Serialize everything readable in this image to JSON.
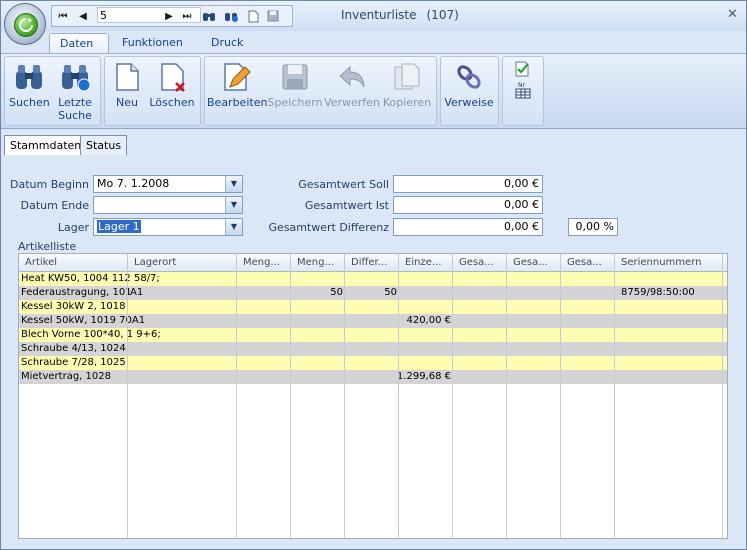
{
  "window": {
    "title": "Inventurliste",
    "count": "(107)",
    "close": "✕"
  },
  "nav": {
    "first": "⏮",
    "prev": "◀",
    "record": "5",
    "next": "▶",
    "last": "⏭"
  },
  "tabs": [
    "Daten",
    "Funktionen",
    "Druck"
  ],
  "ribbon": {
    "suchen": "Suchen",
    "letzte": [
      "Letzte",
      "Suche"
    ],
    "neu": "Neu",
    "loeschen": "Löschen",
    "bearbeiten": "Bearbeiten",
    "speichern": "Speichern",
    "verwerfen": "Verwerfen",
    "kopieren": "Kopieren",
    "verweise": "Verweise"
  },
  "subtabs": [
    "Stammdaten",
    "Status"
  ],
  "form": {
    "datum_beginn_label": "Datum Beginn",
    "datum_beginn_value": "Mo   7.  1.2008",
    "datum_ende_label": "Datum Ende",
    "datum_ende_value": "",
    "lager_label": "Lager",
    "lager_value": "Lager 1",
    "soll_label": "Gesamtwert Soll",
    "soll_value": "0,00 €",
    "ist_label": "Gesamtwert Ist",
    "ist_value": "0,00 €",
    "diff_label": "Gesamtwert Differenz",
    "diff_value": "0,00 €",
    "diff_pct": "0,00 %",
    "artikelliste_label": "Artikelliste"
  },
  "grid": {
    "columns": [
      "Artikel",
      "Lagerort",
      "Meng...",
      "Meng...",
      "Differ...",
      "Einze...",
      "Gesa...",
      "Gesa...",
      "Gesa...",
      "Seriennummern"
    ],
    "rows": [
      {
        "artikel": "Heat KW50, 1004 112 58/7;",
        "lagerort": "",
        "m1": "",
        "m2": "",
        "diff": "",
        "einzel": "",
        "g1": "",
        "g2": "",
        "g3": "",
        "serien": ""
      },
      {
        "artikel": "Federaustragung, 101",
        "lagerort": "A1",
        "m1": "",
        "m2": "50",
        "diff": "50",
        "einzel": "",
        "g1": "",
        "g2": "",
        "g3": "",
        "serien": "8759/98:50:00"
      },
      {
        "artikel": "Kessel 30kW 2, 1018",
        "lagerort": "",
        "m1": "",
        "m2": "",
        "diff": "",
        "einzel": "",
        "g1": "",
        "g2": "",
        "g3": "",
        "serien": ""
      },
      {
        "artikel": "Kessel 50kW, 1019 70A1",
        "lagerort": "",
        "m1": "",
        "m2": "",
        "diff": "",
        "einzel": "420,00 €",
        "g1": "",
        "g2": "",
        "g3": "",
        "serien": ""
      },
      {
        "artikel": "Blech Vorne 100*40, 1 9+6;",
        "lagerort": "",
        "m1": "",
        "m2": "",
        "diff": "",
        "einzel": "",
        "g1": "",
        "g2": "",
        "g3": "",
        "serien": ""
      },
      {
        "artikel": "Schraube 4/13, 1024",
        "lagerort": "",
        "m1": "",
        "m2": "",
        "diff": "",
        "einzel": "",
        "g1": "",
        "g2": "",
        "g3": "",
        "serien": ""
      },
      {
        "artikel": "Schraube 7/28, 1025",
        "lagerort": "",
        "m1": "",
        "m2": "",
        "diff": "",
        "einzel": "",
        "g1": "",
        "g2": "",
        "g3": "",
        "serien": ""
      },
      {
        "artikel": "Mietvertrag, 1028",
        "lagerort": "",
        "m1": "",
        "m2": "",
        "diff": "",
        "einzel": "1.299,68 €",
        "g1": "",
        "g2": "",
        "g3": "",
        "serien": ""
      }
    ]
  },
  "colors": {
    "row_yellow": "#fffdb4",
    "row_gray": "#d4d4d4",
    "ribbon_text": "#15428b",
    "selection": "#316ac5"
  }
}
